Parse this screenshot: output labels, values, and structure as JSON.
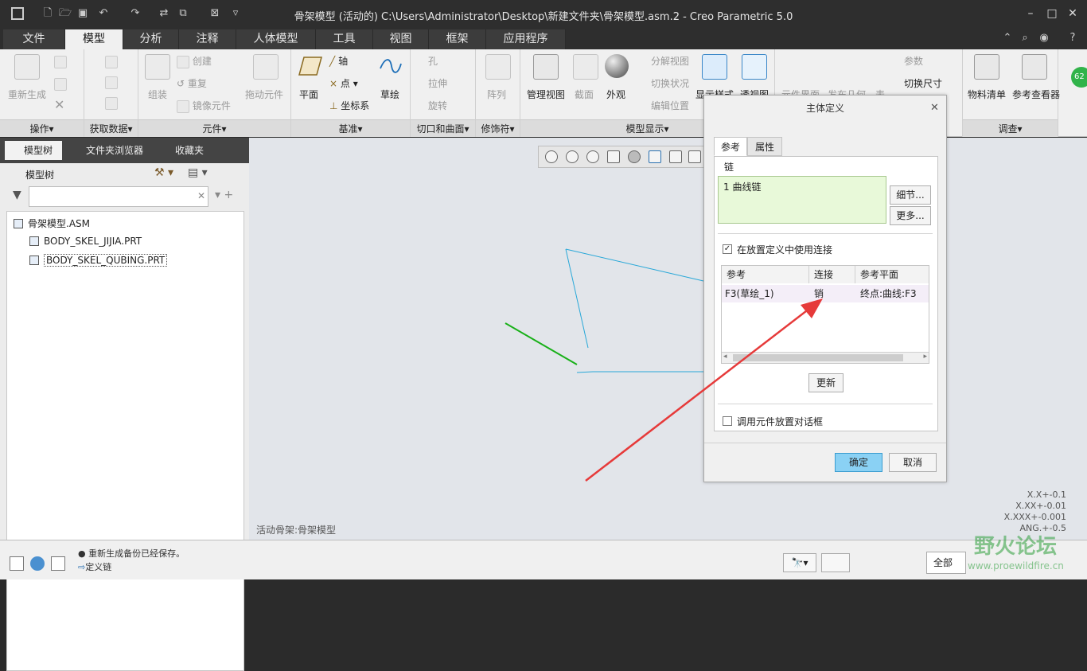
{
  "window": {
    "title": "骨架模型 (活动的) C:\\Users\\Administrator\\Desktop\\新建文件夹\\骨架模型.asm.2 - Creo Parametric 5.0"
  },
  "tabs": [
    "文件",
    "模型",
    "分析",
    "注释",
    "人体模型",
    "工具",
    "视图",
    "框架",
    "应用程序"
  ],
  "ribbon": {
    "operations": {
      "regenerate": "重新生成",
      "label": "操作▾"
    },
    "get_data": {
      "label": "获取数据▾"
    },
    "component": {
      "assemble": "组装",
      "create": "创建",
      "repeat": "重复",
      "mirror": "镜像元件",
      "drag": "拖动元件",
      "label": "元件▾"
    },
    "datum": {
      "plane": "平面",
      "axis": "轴",
      "point": "点",
      "csys": "坐标系",
      "sketch": "草绘",
      "label": "基准▾"
    },
    "cut_surface": {
      "hole": "孔",
      "extrude": "拉伸",
      "revolve": "旋转",
      "label": "切口和曲面▾"
    },
    "modifier": {
      "pattern": "阵列",
      "label": "修饰符▾"
    },
    "model_display": {
      "manage_views": "管理视图",
      "section": "截面",
      "appearance": "外观",
      "exploded": "分解视图",
      "toggle_state": "切换状况",
      "edit_position": "编辑位置",
      "display_style": "显示样式",
      "perspective": "透视图",
      "label": "模型显示▾"
    },
    "extra": {
      "component_interface": "元件界面",
      "publish_geom": "发布几何",
      "table": "表",
      "params": "参数",
      "switch_dims": "切换尺寸"
    },
    "investigate": {
      "bom": "物料清单",
      "ref_viewer": "参考查看器",
      "label": "调查▾"
    }
  },
  "left_panel": {
    "tabs": [
      "模型树",
      "文件夹浏览器",
      "收藏夹"
    ],
    "header": "模型树",
    "tree": [
      "骨架模型.ASM",
      "BODY_SKEL_JIJIA.PRT",
      "BODY_SKEL_QUBING.PRT"
    ]
  },
  "viewport": {
    "status": "活动骨架:骨架模型"
  },
  "tolerances": [
    "X.X+-0.1",
    "X.XX+-0.01",
    "X.XXX+-0.001",
    "ANG.+-0.5"
  ],
  "badge": "62",
  "dialog": {
    "title": "主体定义",
    "tabs": [
      "参考",
      "属性"
    ],
    "chain_label": "链",
    "chain_item": "1 曲线链",
    "details_btn": "细节...",
    "more_btn": "更多...",
    "use_connection": "在放置定义中使用连接",
    "columns": [
      "参考",
      "连接",
      "参考平面"
    ],
    "rows": [
      {
        "ref": "F3(草绘_1)",
        "conn": "销",
        "plane": "终点:曲线:F3"
      }
    ],
    "update_btn": "更新",
    "use_dialog": "调用元件放置对话框",
    "ok": "确定",
    "cancel": "取消"
  },
  "statusbar": {
    "msg1": "● 重新生成备份已经保存。",
    "msg2": "定义链",
    "filter": "全部"
  },
  "watermark": {
    "title": "野火论坛",
    "url": "www.proewildfire.cn"
  }
}
